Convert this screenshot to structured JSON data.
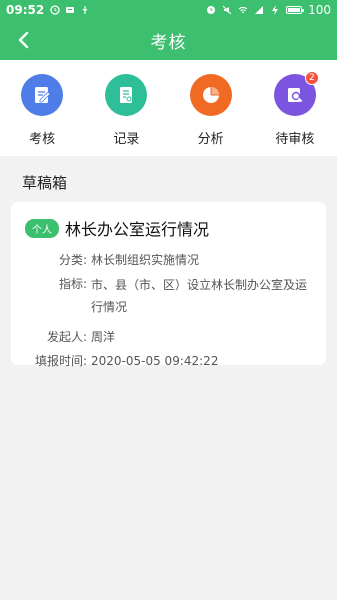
{
  "status_bar": {
    "time": "09:52",
    "battery": "100",
    "icons_left": [
      "clock-icon",
      "notification-icon",
      "usb-icon"
    ],
    "icons_right": [
      "alarm-icon",
      "mute-icon",
      "wifi-icon",
      "signal-icon",
      "charging-icon",
      "battery-icon"
    ]
  },
  "app_bar": {
    "title": "考核",
    "back_icon": "back-arrow-icon"
  },
  "tabs": [
    {
      "label": "考核",
      "icon": "assessment-icon",
      "color": "#4f7de8"
    },
    {
      "label": "记录",
      "icon": "record-icon",
      "color": "#2fbf98"
    },
    {
      "label": "分析",
      "icon": "pie-chart-icon",
      "color": "#f06a23"
    },
    {
      "label": "待审核",
      "icon": "review-search-icon",
      "color": "#7b55e0",
      "badge": "2"
    }
  ],
  "drafts": {
    "section_title": "草稿箱",
    "items": [
      {
        "tag": "个人",
        "title": "林长办公室运行情况",
        "category_label": "分类:",
        "category": "林长制组织实施情况",
        "indicator_label": "指标:",
        "indicator": "市、县（市、区）设立林长制办公室及运行情况",
        "initiator_label": "发起人:",
        "initiator": "周洋",
        "time_label": "填报时间:",
        "time": "2020-05-05 09:42:22"
      }
    ]
  },
  "colors": {
    "primary": "#3cbf6e",
    "badge": "#f2533a",
    "background": "#f2f2f2"
  }
}
